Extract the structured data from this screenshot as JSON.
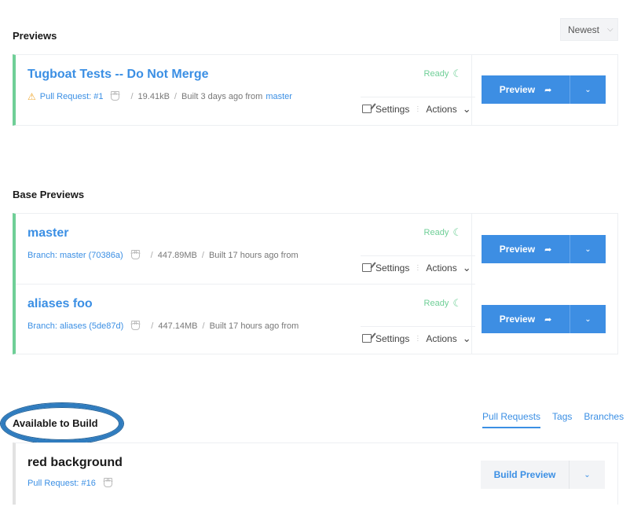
{
  "previews": {
    "title": "Previews",
    "sort": {
      "selected": "Newest"
    },
    "items": [
      {
        "title": "Tugboat Tests -- Do Not Merge",
        "source_label": "Pull Request: #1",
        "size": "19.41kB",
        "built": "Built 3 days ago from",
        "branch_link": "master",
        "status": "Ready",
        "settings_label": "Settings",
        "actions_label": "Actions",
        "preview_label": "Preview"
      }
    ]
  },
  "base_previews": {
    "title": "Base Previews",
    "items": [
      {
        "title": "master",
        "source_label": "Branch: master (70386a)",
        "size": "447.89MB",
        "built": "Built 17 hours ago from",
        "status": "Ready",
        "settings_label": "Settings",
        "actions_label": "Actions",
        "preview_label": "Preview"
      },
      {
        "title": "aliases foo",
        "source_label": "Branch: aliases (5de87d)",
        "size": "447.14MB",
        "built": "Built 17 hours ago from",
        "status": "Ready",
        "settings_label": "Settings",
        "actions_label": "Actions",
        "preview_label": "Preview"
      }
    ]
  },
  "available": {
    "title": "Available to Build",
    "tabs": [
      {
        "label": "Pull Requests",
        "active": true
      },
      {
        "label": "Tags",
        "active": false
      },
      {
        "label": "Branches",
        "active": false
      }
    ],
    "items": [
      {
        "title": "red background",
        "source_label": "Pull Request: #16",
        "build_label": "Build Preview"
      }
    ]
  },
  "colors": {
    "accent": "#3d8ee3",
    "ready_green": "#6fcf97",
    "highlight_ring": "#2f7cbf"
  },
  "icons": {
    "warning": "warning-triangle-icon",
    "github": "github-icon",
    "moon": "moon-icon",
    "edit": "edit-icon",
    "share": "share-icon",
    "chevron": "chevron-down-icon"
  }
}
